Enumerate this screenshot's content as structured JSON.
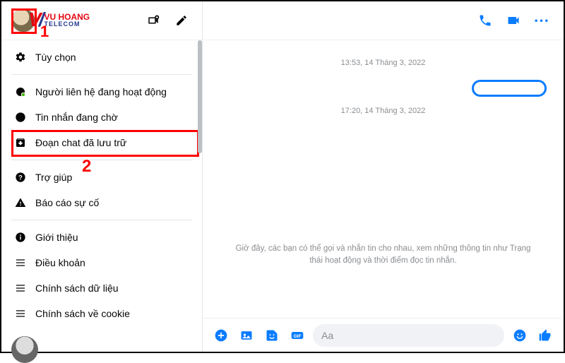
{
  "sidebar": {
    "logo": {
      "line1": "VU HOANG",
      "line2": "TELECOM"
    },
    "menu": [
      {
        "label": "Tùy chọn"
      },
      {
        "label": "Người liên hệ đang hoạt động"
      },
      {
        "label": "Tin nhắn đang chờ"
      },
      {
        "label": "Đoạn chat đã lưu trữ"
      },
      {
        "label": "Trợ giúp"
      },
      {
        "label": "Báo cáo sự cố"
      },
      {
        "label": "Giới thiệu"
      },
      {
        "label": "Điều khoản"
      },
      {
        "label": "Chính sách dữ liệu"
      },
      {
        "label": "Chính sách về cookie"
      }
    ]
  },
  "annotations": {
    "step1": "1",
    "step2": "2"
  },
  "chat": {
    "timestamps": [
      "13:53, 14 Tháng 3, 2022",
      "17:20, 14 Tháng 3, 2022"
    ],
    "systemMessage": "Giờ đây, các bạn có thể gọi và nhắn tin cho nhau, xem những thông tin như Trạng thái hoạt động và thời điểm đọc tin nhắn.",
    "composer": {
      "placeholder": "Aa"
    }
  },
  "colors": {
    "accent": "#0a7cff",
    "annotation": "#ff0000"
  }
}
